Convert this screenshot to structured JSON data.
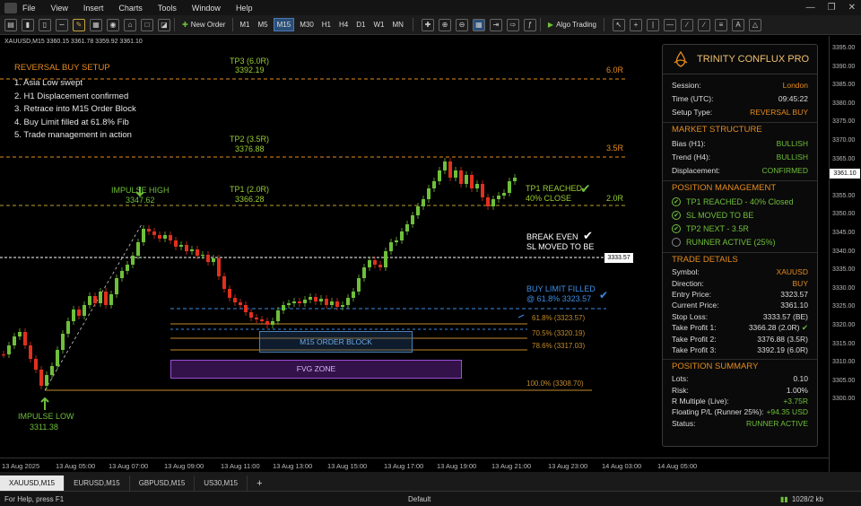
{
  "menu": {
    "items": [
      "File",
      "View",
      "Insert",
      "Charts",
      "Tools",
      "Window",
      "Help"
    ]
  },
  "toolbar": {
    "new_order": "New Order",
    "timeframes": [
      "M1",
      "M5",
      "M15",
      "M30",
      "H1",
      "H4",
      "D1",
      "W1",
      "MN"
    ],
    "active_tf": "M15",
    "algo_trading": "Algo Trading"
  },
  "chart_header": {
    "symbol_line": "XAUUSD,M15  3360.15 3361.78 3359.92 3361.10"
  },
  "setup": {
    "title": "REVERSAL BUY SETUP",
    "steps": [
      "1.  Asia Low swept",
      "2.  H1 Displacement confirmed",
      "3.  Retrace into M15 Order Block",
      "4.  Buy Limit filled at 61.8% Fib",
      "5.  Trade management in action"
    ]
  },
  "annotations": {
    "tp3_name": "TP3 (6.0R)",
    "tp3_price": "3392.19",
    "tp3_r": "6.0R",
    "tp2_name": "TP2 (3.5R)",
    "tp2_price": "3376.88",
    "tp2_r": "3.5R",
    "tp1_name": "TP1 (2.0R)",
    "tp1_price": "3366.28",
    "tp1_r": "2.0R",
    "impulse_high": "IMPULSE HIGH",
    "impulse_high_price": "3347.62",
    "impulse_low": "IMPULSE LOW",
    "impulse_low_price": "3311.38",
    "tp1_reached": "TP1 REACHED",
    "tp1_close": "40% CLOSE",
    "break_even": "BREAK EVEN",
    "sl_moved": "SL MOVED TO BE",
    "buy_limit": "BUY LIMIT FILLED",
    "buy_limit_at": "@ 61.8% 3323.57",
    "entry_tag": "3333.57",
    "fib_618": "61.8%  (3323.57)",
    "fib_705": "70.5%  (3320.19)",
    "fib_786": "78.6%  (3317.03)",
    "fib_100": "100.0%  (3308.70)",
    "order_block": "M15 ORDER BLOCK",
    "fvg": "FVG ZONE"
  },
  "panel": {
    "title": "TRINITY CONFLUX PRO",
    "session_label": "Session:",
    "session": "London",
    "time_label": "Time (UTC):",
    "time": "09:45:22",
    "setup_label": "Setup Type:",
    "setup": "REVERSAL BUY",
    "ms_title": "MARKET STRUCTURE",
    "bias_label": "Bias (H1):",
    "bias": "BULLISH",
    "trend_label": "Trend (H4):",
    "trend": "BULLISH",
    "disp_label": "Displacement:",
    "disp": "CONFIRMED",
    "pm_title": "POSITION MANAGEMENT",
    "pm_items": [
      "TP1 REACHED - 40% Closed",
      "SL MOVED TO BE",
      "TP2 NEXT - 3.5R",
      "RUNNER ACTIVE (25%)"
    ],
    "td_title": "TRADE DETAILS",
    "td": [
      {
        "k": "Symbol:",
        "v": "XAUUSD"
      },
      {
        "k": "Direction:",
        "v": "BUY"
      },
      {
        "k": "Entry Price:",
        "v": "3323.57"
      },
      {
        "k": "Current Price:",
        "v": "3361.10"
      },
      {
        "k": "Stop Loss:",
        "v": "3333.57 (BE)"
      },
      {
        "k": "Take Profit 1:",
        "v": "3366.28 (2.0R)"
      },
      {
        "k": "Take Profit 2:",
        "v": "3376.88 (3.5R)"
      },
      {
        "k": "Take Profit 3:",
        "v": "3392.19 (6.0R)"
      }
    ],
    "ps_title": "POSITION SUMMARY",
    "ps": [
      {
        "k": "Lots:",
        "v": "0.10"
      },
      {
        "k": "Risk:",
        "v": "1.00%"
      },
      {
        "k": "R Multiple (Live):",
        "v": "+3.75R"
      },
      {
        "k": "Floating P/L (Runner 25%):",
        "v": "+94.35 USD"
      },
      {
        "k": "Status:",
        "v": "RUNNER ACTIVE"
      }
    ]
  },
  "price_axis": {
    "ticks": [
      "3395.00",
      "3390.00",
      "3385.00",
      "3380.00",
      "3375.00",
      "3370.00",
      "3365.00",
      "3360.00",
      "3355.00",
      "3350.00",
      "3345.00",
      "3340.00",
      "3335.00",
      "3330.00",
      "3325.00",
      "3320.00",
      "3315.00",
      "3310.00",
      "3305.00",
      "3300.00"
    ],
    "current": "3361.10",
    "entry": "3333.57"
  },
  "time_axis": {
    "ticks": [
      "13 Aug 2025",
      "13 Aug 05:00",
      "13 Aug 07:00",
      "13 Aug 09:00",
      "13 Aug 11:00",
      "13 Aug 13:00",
      "13 Aug 15:00",
      "13 Aug 17:00",
      "13 Aug 19:00",
      "13 Aug 21:00",
      "13 Aug 23:00",
      "14 Aug 03:00",
      "14 Aug 05:00"
    ]
  },
  "tabs": {
    "items": [
      "XAUUSD,M15",
      "EURUSD,M15",
      "GBPUSD,M15",
      "US30,M15"
    ],
    "active": "XAUUSD,M15",
    "add": "+"
  },
  "status": {
    "help": "For Help, press F1",
    "profile": "Default",
    "traffic": "1028/2 kb"
  },
  "colors": {
    "up": "#6fbf3a",
    "down": "#e0301e",
    "accent": "#e58b1e",
    "level": "#c28a2a",
    "tp_green": "#9acd32",
    "blue": "#3a8ee6",
    "fvg": "#9b4fd6"
  }
}
